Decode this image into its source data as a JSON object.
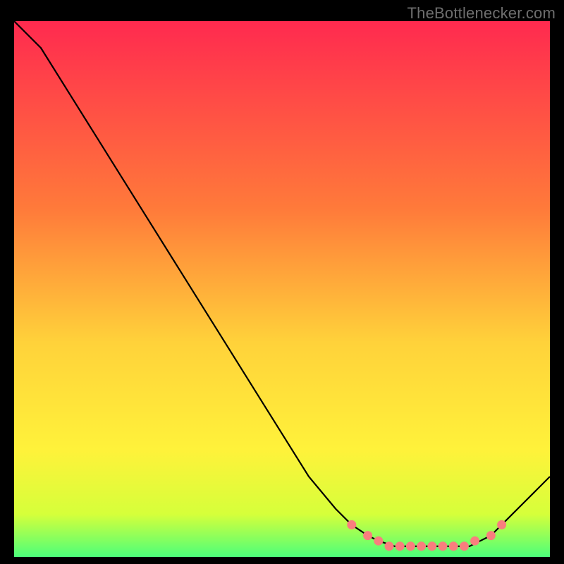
{
  "watermark": "TheBottlenecker.com",
  "colors": {
    "black": "#000000",
    "curve": "#000000",
    "marker_fill": "#f97e7e",
    "marker_stroke": "#f97e7e",
    "grad_top": "#ff2a4f",
    "grad_mid1": "#ff7a3a",
    "grad_mid2": "#ffd23a",
    "grad_mid3": "#fff23a",
    "grad_bottom1": "#d6ff3a",
    "grad_bottom2": "#4cff7a"
  },
  "chart_data": {
    "type": "line",
    "title": "",
    "xlabel": "",
    "ylabel": "",
    "xlim": [
      0,
      100
    ],
    "ylim": [
      0,
      100
    ],
    "series": [
      {
        "name": "curve",
        "x": [
          0,
          5,
          10,
          15,
          20,
          25,
          30,
          35,
          40,
          45,
          50,
          55,
          60,
          63,
          66,
          68,
          71,
          73,
          75,
          77,
          79,
          81,
          83,
          85,
          87,
          89,
          91,
          93,
          95,
          97,
          100
        ],
        "y": [
          100,
          95,
          87,
          79,
          71,
          63,
          55,
          47,
          39,
          31,
          23,
          15,
          9,
          6,
          4,
          3,
          2,
          2,
          2,
          2,
          2,
          2,
          2,
          2,
          3,
          4,
          6,
          8,
          10,
          12,
          15
        ]
      }
    ],
    "markers": {
      "name": "highlighted-band",
      "x": [
        63,
        66,
        68,
        70,
        72,
        74,
        76,
        78,
        80,
        82,
        84,
        86,
        89,
        91
      ],
      "y": [
        6,
        4,
        3,
        2,
        2,
        2,
        2,
        2,
        2,
        2,
        2,
        3,
        4,
        6
      ]
    },
    "gradient_stops": [
      {
        "offset": 0.0,
        "key": "grad_top"
      },
      {
        "offset": 0.35,
        "key": "grad_mid1"
      },
      {
        "offset": 0.6,
        "key": "grad_mid2"
      },
      {
        "offset": 0.8,
        "key": "grad_mid3"
      },
      {
        "offset": 0.92,
        "key": "grad_bottom1"
      },
      {
        "offset": 1.0,
        "key": "grad_bottom2"
      }
    ]
  }
}
